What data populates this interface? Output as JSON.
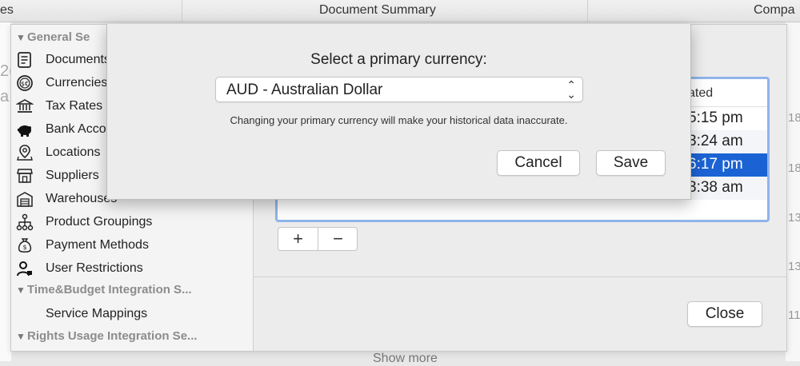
{
  "top_header": {
    "col_left": "es",
    "col_middle": "Document Summary",
    "col_right": "Compa"
  },
  "background": {
    "frag_a": "2(",
    "frag_b": "a",
    "right_values": [
      "18",
      "18",
      "13",
      "13",
      "11"
    ],
    "show_more": "Show more"
  },
  "sidebar": {
    "section_general": "General Se",
    "items": [
      {
        "label": "Documents",
        "icon": "document-icon"
      },
      {
        "label": "Currencies",
        "icon": "currency-icon"
      },
      {
        "label": "Tax Rates",
        "icon": "bank-icon"
      },
      {
        "label": "Bank Accounts",
        "icon": "piggy-bank-icon"
      },
      {
        "label": "Locations",
        "icon": "location-pin-icon"
      },
      {
        "label": "Suppliers",
        "icon": "store-icon"
      },
      {
        "label": "Warehouses",
        "icon": "warehouse-icon"
      },
      {
        "label": "Product Groupings",
        "icon": "hierarchy-icon"
      },
      {
        "label": "Payment Methods",
        "icon": "money-bag-icon"
      },
      {
        "label": "User Restrictions",
        "icon": "user-lock-icon"
      }
    ],
    "section_time_budget": "Time&Budget Integration S...",
    "service_mappings": "Service Mappings",
    "section_rights_usage": "Rights Usage Integration Se..."
  },
  "list": {
    "header": "ated",
    "rows": [
      "5:15 pm",
      "3:24 am",
      "6:17 pm",
      "3:38 am"
    ]
  },
  "buttons": {
    "add": "+",
    "remove": "−",
    "close": "Close"
  },
  "sheet": {
    "title": "Select a primary currency:",
    "selected_currency": "AUD - Australian Dollar",
    "warning": "Changing your primary currency will make your historical data inaccurate.",
    "cancel": "Cancel",
    "save": "Save"
  },
  "colors": {
    "selection": "#1b63d4",
    "focus_ring": "#8fb4ea"
  }
}
